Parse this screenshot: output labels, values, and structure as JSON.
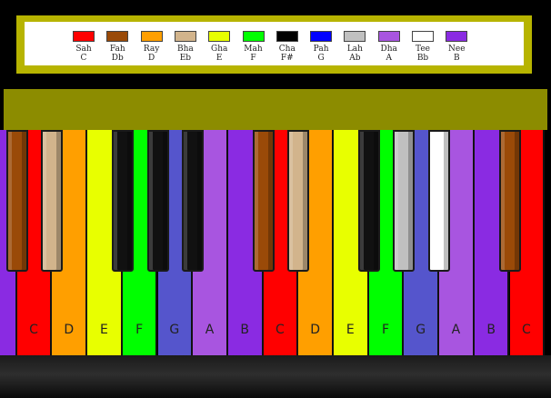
{
  "legend": [
    {
      "sargam": "Sah",
      "note": "C",
      "color": "#ff0000"
    },
    {
      "sargam": "Fah",
      "note": "Db",
      "color": "#9a4a08"
    },
    {
      "sargam": "Ray",
      "note": "D",
      "color": "#ff9f00"
    },
    {
      "sargam": "Bha",
      "note": "Eb",
      "color": "#d2b48c"
    },
    {
      "sargam": "Gha",
      "note": "E",
      "color": "#e8ff00"
    },
    {
      "sargam": "Mah",
      "note": "F",
      "color": "#00ff00"
    },
    {
      "sargam": "Cha",
      "note": "F#",
      "color": "#000000"
    },
    {
      "sargam": "Pah",
      "note": "G",
      "color": "#0000ff"
    },
    {
      "sargam": "Lah",
      "note": "Ab",
      "color": "#c0c0c0"
    },
    {
      "sargam": "Dha",
      "note": "A",
      "color": "#a855e0"
    },
    {
      "sargam": "Tee",
      "note": "Bb",
      "color": "#ffffff"
    },
    {
      "sargam": "Nee",
      "note": "B",
      "color": "#8a2be2"
    }
  ],
  "white_keys": [
    {
      "label": "",
      "color": "#8a2be2"
    },
    {
      "label": "C",
      "color": "#ff0000"
    },
    {
      "label": "D",
      "color": "#ff9f00"
    },
    {
      "label": "E",
      "color": "#e8ff00"
    },
    {
      "label": "F",
      "color": "#00ff00"
    },
    {
      "label": "G",
      "color": "#5555cc"
    },
    {
      "label": "A",
      "color": "#a855e0"
    },
    {
      "label": "B",
      "color": "#8a2be2"
    },
    {
      "label": "C",
      "color": "#ff0000"
    },
    {
      "label": "D",
      "color": "#ff9f00"
    },
    {
      "label": "E",
      "color": "#e8ff00"
    },
    {
      "label": "F",
      "color": "#00ff00"
    },
    {
      "label": "G",
      "color": "#5555cc"
    },
    {
      "label": "A",
      "color": "#a855e0"
    },
    {
      "label": "B",
      "color": "#8a2be2"
    },
    {
      "label": "C",
      "color": "#ff0000"
    }
  ],
  "black_keys": [
    {
      "note": "Db",
      "color": "#9a4a08",
      "after": 1
    },
    {
      "note": "Eb",
      "color": "#d2b48c",
      "after": 2
    },
    {
      "note": "F#",
      "color": "#111111",
      "after": 4
    },
    {
      "note": "Ab",
      "color": "#111111",
      "after": 5
    },
    {
      "note": "Bb",
      "color": "#111111",
      "after": 6
    },
    {
      "note": "Db",
      "color": "#9a4a08",
      "after": 8
    },
    {
      "note": "Eb",
      "color": "#d2b48c",
      "after": 9
    },
    {
      "note": "F#",
      "color": "#111111",
      "after": 11
    },
    {
      "note": "Ab",
      "color": "#c0c0c0",
      "after": 12
    },
    {
      "note": "Bb",
      "color": "#ffffff",
      "after": 13
    },
    {
      "note": "Db",
      "color": "#9a4a08",
      "after": 15
    }
  ],
  "colors": {
    "frame": "#b7b400",
    "olive_bar": "#8c8c00"
  }
}
